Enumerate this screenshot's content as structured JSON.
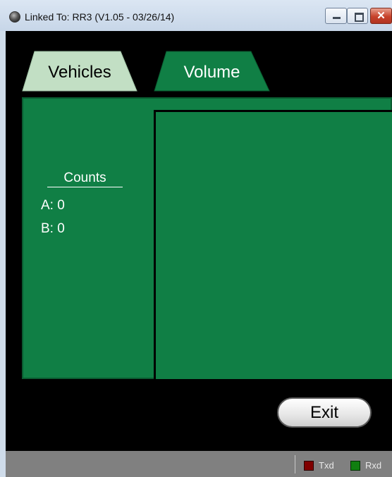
{
  "window": {
    "title": "Linked To: RR3  (V1.05  - 03/26/14)",
    "app_icon": "globe-icon",
    "controls": {
      "minimize_icon": "minimize-icon",
      "maximize_icon": "maximize-icon",
      "close_glyph": "✕"
    }
  },
  "tabs": [
    {
      "label": "Vehicles",
      "selected": false,
      "color": "#c2dfc4"
    },
    {
      "label": "Volume",
      "selected": true,
      "color": "#107f45"
    }
  ],
  "counts": {
    "title": "Counts",
    "a": "A: 0",
    "b": "B: 0"
  },
  "exit_button": {
    "label": "Exit"
  },
  "status": {
    "txd": {
      "label": "Txd",
      "color": "#800000"
    },
    "rxd": {
      "label": "Rxd",
      "color": "#107f10"
    }
  },
  "colors": {
    "panel_green": "#107f45",
    "background": "#000000",
    "statusbar": "#808080"
  }
}
